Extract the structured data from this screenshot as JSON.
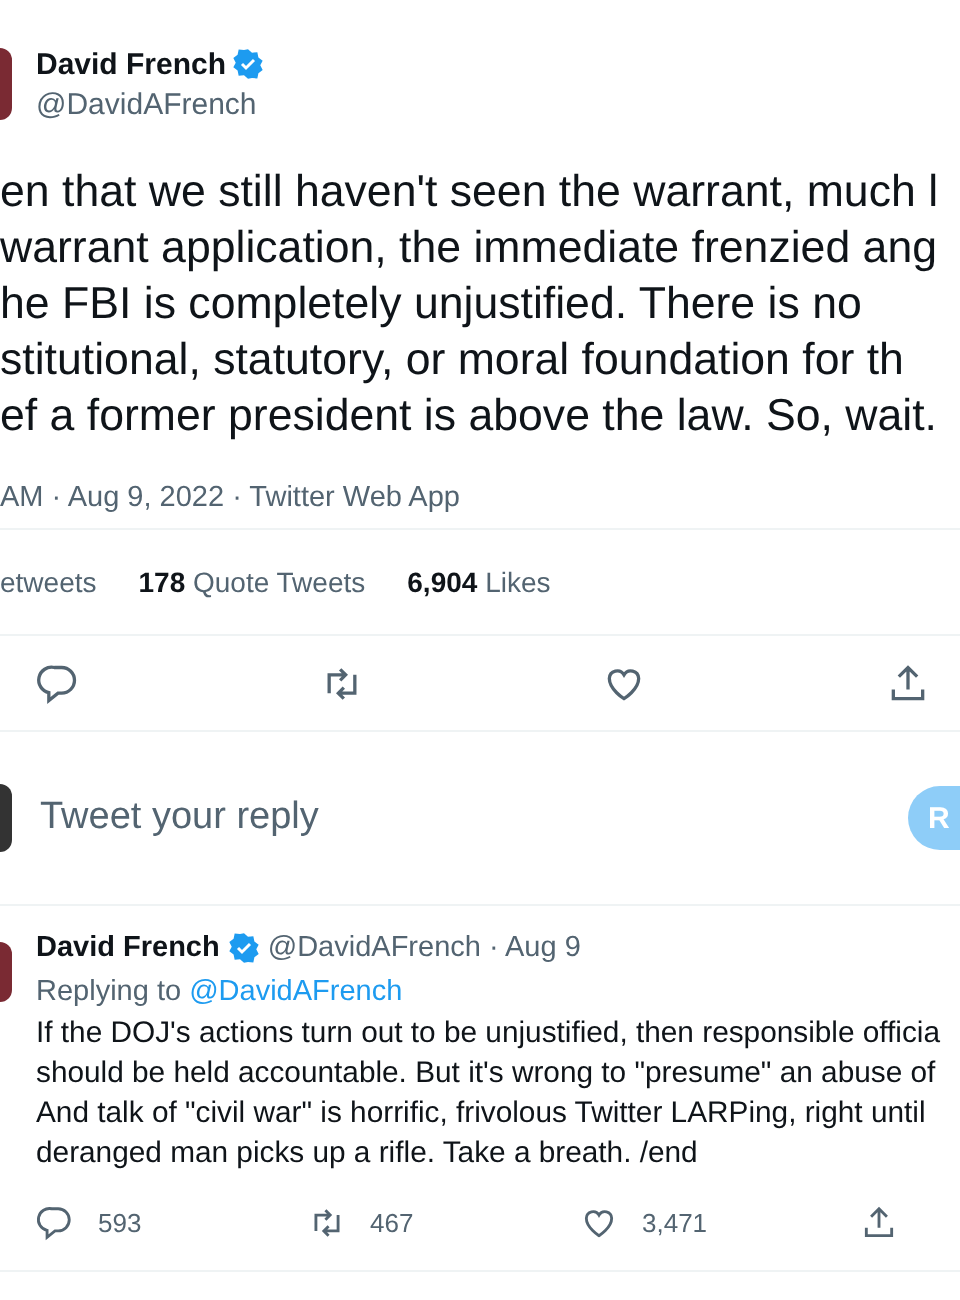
{
  "tweet": {
    "author": {
      "name": "David French",
      "verified": true,
      "handle": "@DavidAFrench"
    },
    "text_lines": [
      "en that we still haven't seen the warrant, much l",
      "warrant application, the immediate frenzied ang",
      "he FBI is completely unjustified. There is no",
      "stitutional, statutory, or moral foundation for th",
      "ef a former president is above the law. So, wait."
    ],
    "meta": "AM · Aug 9, 2022 · Twitter Web App",
    "stats": [
      {
        "label": "etweets"
      },
      {
        "count": "178",
        "label": "Quote Tweets"
      },
      {
        "count": "6,904",
        "label": "Likes"
      }
    ],
    "actions": [
      {
        "kind": "reply"
      },
      {
        "kind": "retweet"
      },
      {
        "kind": "like"
      },
      {
        "kind": "share"
      }
    ]
  },
  "composer": {
    "placeholder": "Tweet your reply",
    "button": "R"
  },
  "reply": {
    "author": {
      "name": "David French",
      "verified": true,
      "handle": "@DavidAFrench",
      "date": "· Aug 9"
    },
    "replying_prefix": "Replying to",
    "replying_to": "@DavidAFrench",
    "text_lines": [
      "If the DOJ's actions turn out to be unjustified, then responsible officia",
      "should be held accountable. But it's wrong to \"presume\" an abuse of",
      "And talk of \"civil war\" is horrific, frivolous Twitter LARPing, right until",
      "deranged man picks up a rifle. Take a breath. /end"
    ],
    "actions": [
      {
        "kind": "reply",
        "count": "593"
      },
      {
        "kind": "retweet",
        "count": "467"
      },
      {
        "kind": "like",
        "count": "3,471"
      },
      {
        "kind": "share"
      }
    ]
  }
}
